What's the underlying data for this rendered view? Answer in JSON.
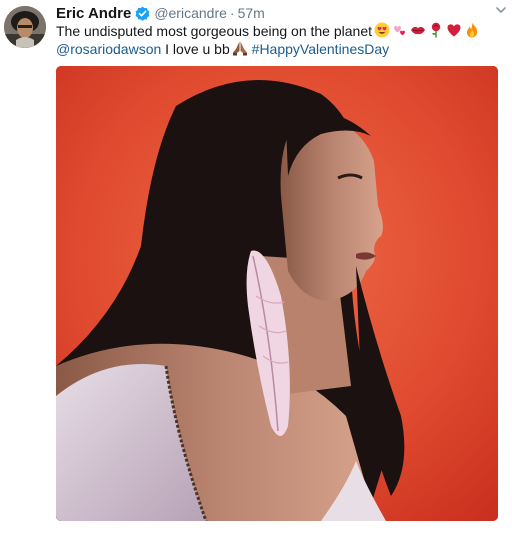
{
  "tweet": {
    "author_name": "Eric Andre",
    "author_handle": "@ericandre",
    "separator": "·",
    "timestamp": "57m",
    "text_line1": "The undisputed most gorgeous being on the planet",
    "mention": "@rosariodawson",
    "text_middle": " I love u bb",
    "hashtag": "#HappyValentinesDay"
  },
  "icons": {
    "verified": "verified-badge-icon",
    "caret": "chevron-down-icon",
    "emoji": [
      "heart-eyes-emoji",
      "two-hearts-emoji",
      "kiss-mark-emoji",
      "rose-emoji",
      "red-heart-emoji",
      "fire-emoji",
      "folded-hands-emoji"
    ]
  },
  "colors": {
    "link": "#1b5c8f",
    "verified": "#1da1f2",
    "photo_background": "#e24a2e"
  }
}
